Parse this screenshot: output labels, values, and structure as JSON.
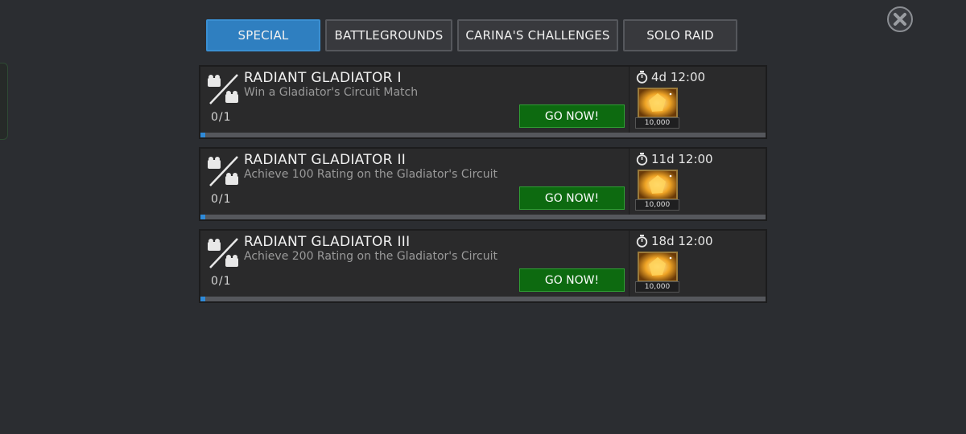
{
  "tabs": [
    {
      "label": "SPECIAL",
      "active": true
    },
    {
      "label": "BATTLEGROUNDS",
      "active": false
    },
    {
      "label": "CARINA'S CHALLENGES",
      "active": false
    },
    {
      "label": "SOLO RAID",
      "active": false
    }
  ],
  "close_icon": "close-icon",
  "quests": [
    {
      "title": "RADIANT GLADIATOR I",
      "description": "Win a Gladiator's Circuit Match",
      "progress": "0/1",
      "progress_fraction": 0,
      "button": "GO NOW!",
      "timer": "4d 12:00",
      "reward_amount": "10,000",
      "icon": "gladiator-versus-icon",
      "reward_icon": "crystal-reward-icon"
    },
    {
      "title": "RADIANT GLADIATOR II",
      "description": "Achieve 100 Rating on the Gladiator's Circuit",
      "progress": "0/1",
      "progress_fraction": 0,
      "button": "GO NOW!",
      "timer": "11d 12:00",
      "reward_amount": "10,000",
      "icon": "gladiator-versus-icon",
      "reward_icon": "crystal-reward-icon"
    },
    {
      "title": "RADIANT GLADIATOR III",
      "description": "Achieve 200 Rating on the Gladiator's Circuit",
      "progress": "0/1",
      "progress_fraction": 0,
      "button": "GO NOW!",
      "timer": "18d 12:00",
      "reward_amount": "10,000",
      "icon": "gladiator-versus-icon",
      "reward_icon": "crystal-reward-icon"
    }
  ],
  "colors": {
    "background": "#2b2d31",
    "tab_active": "#2f7fc0",
    "button_green": "#0d6a10",
    "progress_blue": "#2f8ad8"
  }
}
